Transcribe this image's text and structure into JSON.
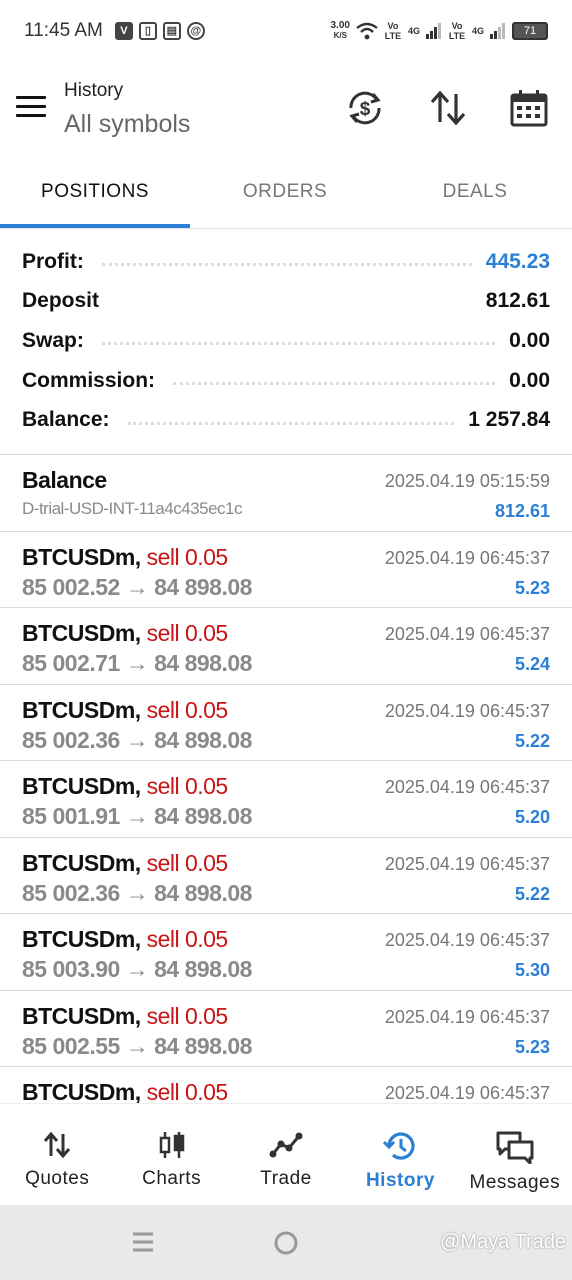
{
  "status_bar": {
    "time": "11:45 AM",
    "net_speed_value": "3.00",
    "net_speed_unit": "K/S",
    "sim1_label": "Vo LTE",
    "sim1_gen": "4G",
    "sim2_label": "Vo LTE",
    "sim2_gen": "4G",
    "battery": "71"
  },
  "header": {
    "title": "History",
    "subtitle": "All symbols"
  },
  "tabs": [
    {
      "label": "POSITIONS",
      "active": true
    },
    {
      "label": "ORDERS",
      "active": false
    },
    {
      "label": "DEALS",
      "active": false
    }
  ],
  "summary": {
    "profit_label": "Profit:",
    "profit_value": "445.23",
    "deposit_label": "Deposit",
    "deposit_value": "812.61",
    "swap_label": "Swap:",
    "swap_value": "0.00",
    "commission_label": "Commission:",
    "commission_value": "0.00",
    "balance_label": "Balance:",
    "balance_value": "1 257.84"
  },
  "balance_entry": {
    "title": "Balance",
    "account": "D-trial-USD-INT-11a4c435ec1c",
    "time": "2025.04.19 05:15:59",
    "amount": "812.61"
  },
  "positions": [
    {
      "symbol": "BTCUSDm,",
      "side": "sell 0.05",
      "open": "85 002.52",
      "arrow": "→",
      "close": "84 898.08",
      "time": "2025.04.19 06:45:37",
      "profit": "5.23"
    },
    {
      "symbol": "BTCUSDm,",
      "side": "sell 0.05",
      "open": "85 002.71",
      "arrow": "→",
      "close": "84 898.08",
      "time": "2025.04.19 06:45:37",
      "profit": "5.24"
    },
    {
      "symbol": "BTCUSDm,",
      "side": "sell 0.05",
      "open": "85 002.36",
      "arrow": "→",
      "close": "84 898.08",
      "time": "2025.04.19 06:45:37",
      "profit": "5.22"
    },
    {
      "symbol": "BTCUSDm,",
      "side": "sell 0.05",
      "open": "85 001.91",
      "arrow": "→",
      "close": "84 898.08",
      "time": "2025.04.19 06:45:37",
      "profit": "5.20"
    },
    {
      "symbol": "BTCUSDm,",
      "side": "sell 0.05",
      "open": "85 002.36",
      "arrow": "→",
      "close": "84 898.08",
      "time": "2025.04.19 06:45:37",
      "profit": "5.22"
    },
    {
      "symbol": "BTCUSDm,",
      "side": "sell 0.05",
      "open": "85 003.90",
      "arrow": "→",
      "close": "84 898.08",
      "time": "2025.04.19 06:45:37",
      "profit": "5.30"
    },
    {
      "symbol": "BTCUSDm,",
      "side": "sell 0.05",
      "open": "85 002.55",
      "arrow": "→",
      "close": "84 898.08",
      "time": "2025.04.19 06:45:37",
      "profit": "5.23"
    },
    {
      "symbol": "BTCUSDm,",
      "side": "sell 0.05",
      "open": "",
      "arrow": "",
      "close": "",
      "time": "2025.04.19 06:45:37",
      "profit": ""
    }
  ],
  "bottom_nav": [
    {
      "label": "Quotes",
      "icon": "quotes-icon",
      "active": false
    },
    {
      "label": "Charts",
      "icon": "charts-icon",
      "active": false
    },
    {
      "label": "Trade",
      "icon": "trade-icon",
      "active": false
    },
    {
      "label": "History",
      "icon": "history-icon",
      "active": true
    },
    {
      "label": "Messages",
      "icon": "messages-icon",
      "active": false
    }
  ],
  "watermark": "@Maya Trade",
  "colors": {
    "accent": "#2b7fd4",
    "sell": "#c81414",
    "muted": "#8a8a8a"
  }
}
